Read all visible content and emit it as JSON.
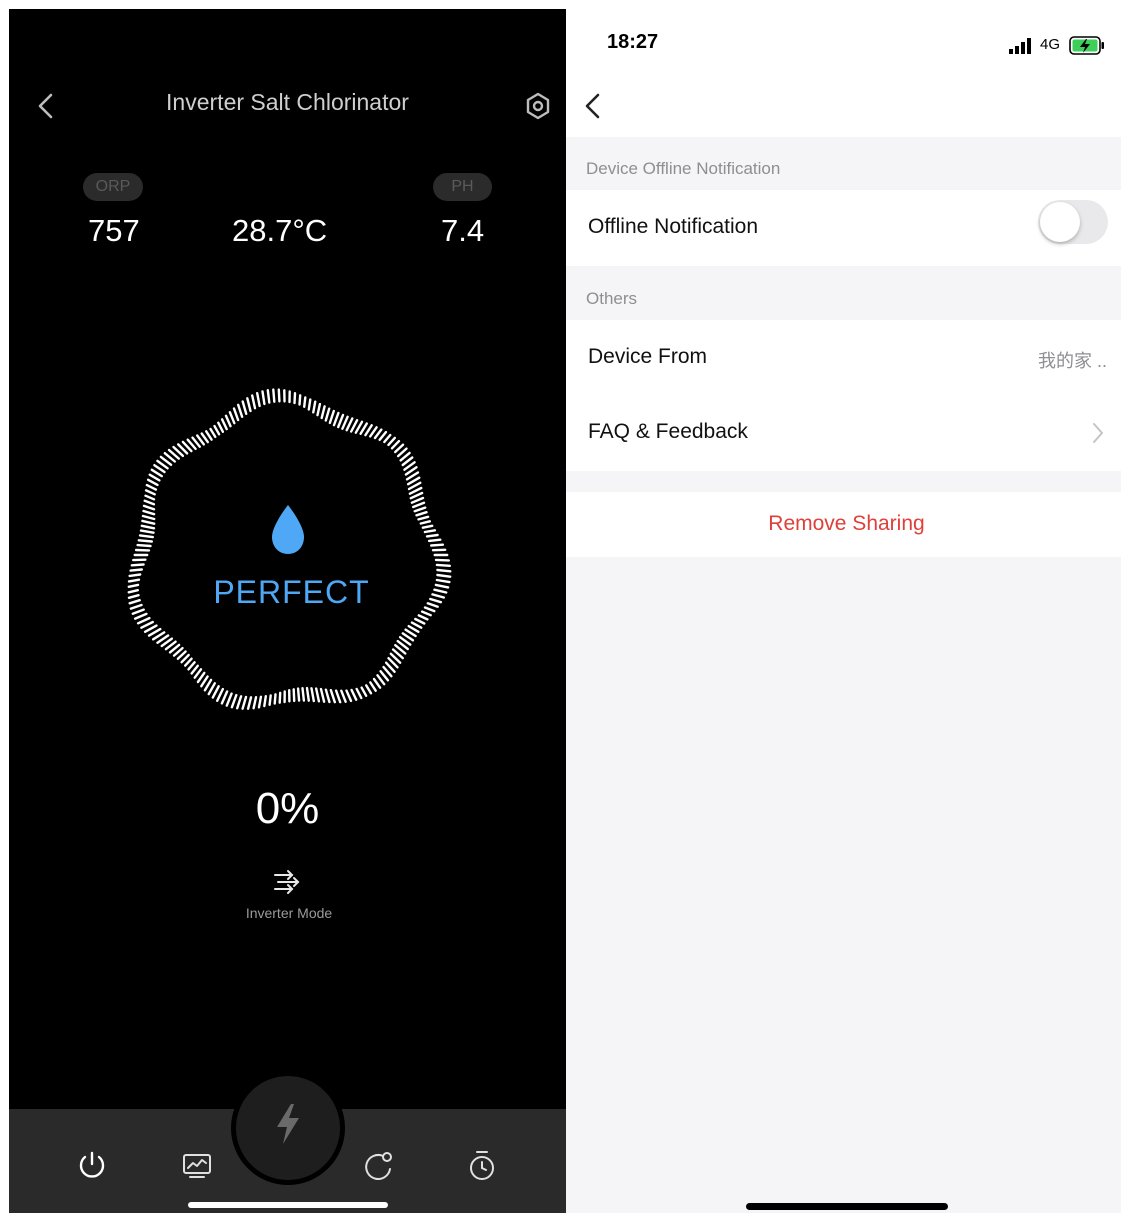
{
  "left": {
    "title": "Inverter Salt Chlorinator",
    "orp_label": "ORP",
    "orp_value": "757",
    "temperature": "28.7°C",
    "ph_label": "PH",
    "ph_value": "7.4",
    "status": "PERFECT",
    "output_percent": "0%",
    "mode_label": "Inverter Mode",
    "accent_color": "#4fa8f5",
    "tabs": [
      "power-icon",
      "monitor-chart-icon",
      "bolt-icon",
      "cycle-icon",
      "timer-icon"
    ]
  },
  "right": {
    "status_time": "18:27",
    "network": "4G",
    "section_offline": "Device Offline Notification",
    "offline_label": "Offline Notification",
    "offline_enabled": false,
    "section_others": "Others",
    "device_from_label": "Device From",
    "device_from_value": "我的家 ..",
    "faq_label": "FAQ & Feedback",
    "remove_label": "Remove Sharing",
    "danger_color": "#e0403a"
  }
}
